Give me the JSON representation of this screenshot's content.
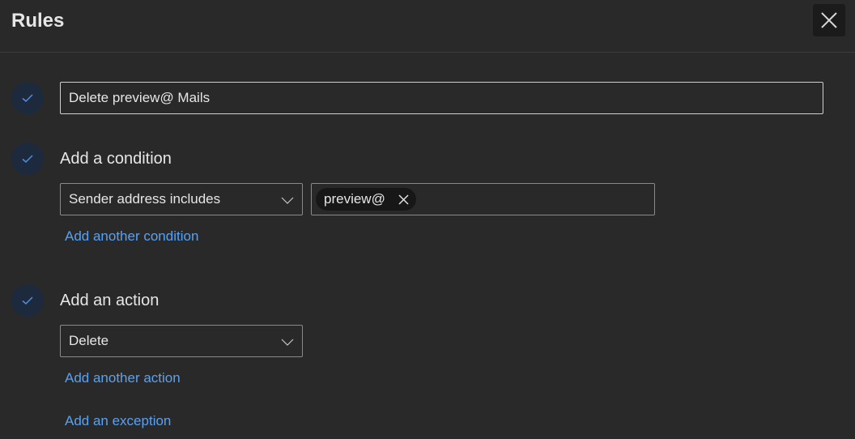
{
  "header": {
    "title": "Rules"
  },
  "rule": {
    "name_value": "Delete preview@ Mails"
  },
  "condition": {
    "label": "Add a condition",
    "selected": "Sender address includes",
    "chip": "preview@",
    "add_link": "Add another condition"
  },
  "action": {
    "label": "Add an action",
    "selected": "Delete",
    "add_link": "Add another action"
  },
  "exception": {
    "add_link": "Add an exception"
  },
  "colors": {
    "background": "#292929",
    "link": "#5aa1f0",
    "check": "#4f8fdc",
    "check_circle": "#1d2a3d"
  },
  "icons": {
    "close": "close-icon",
    "check": "checkmark-icon",
    "chevron": "chevron-down-icon",
    "chip_remove": "dismiss-icon"
  }
}
